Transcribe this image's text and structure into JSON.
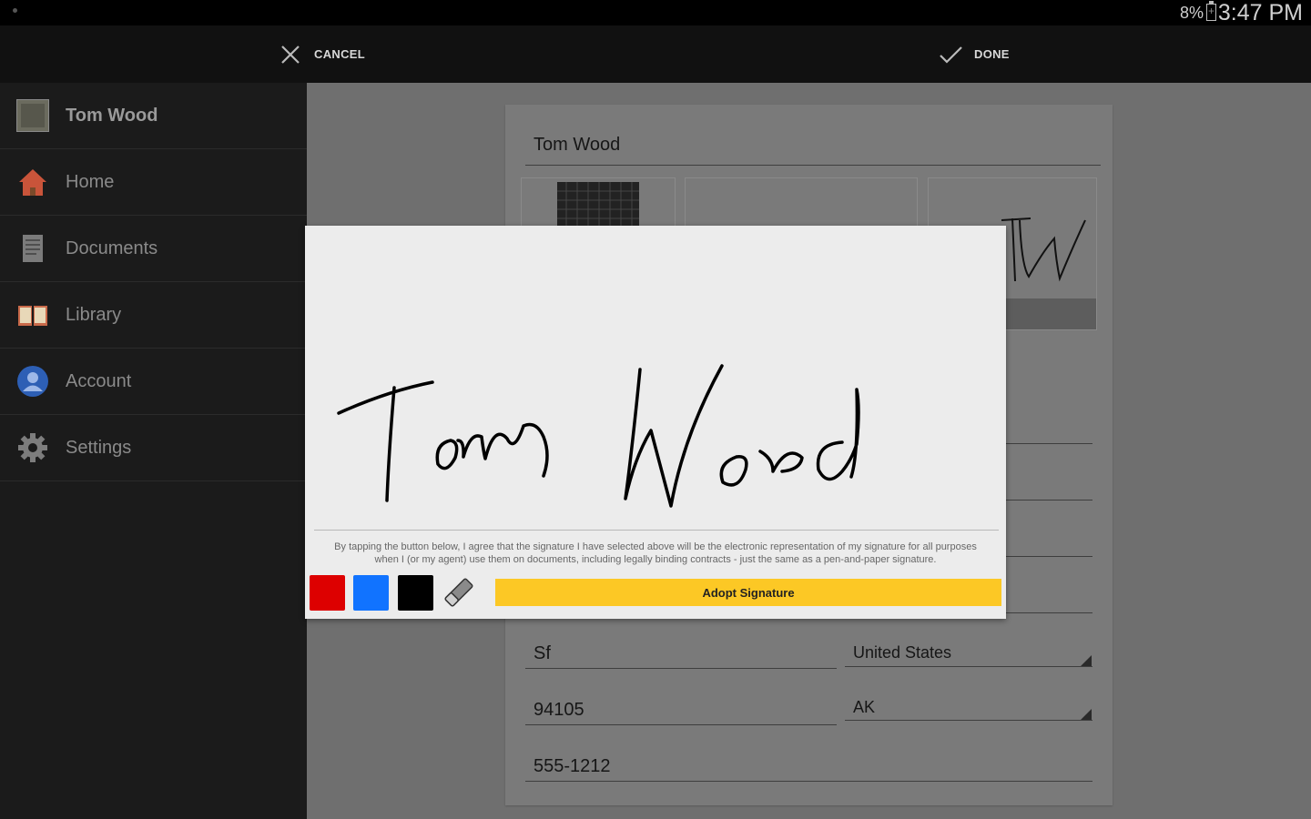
{
  "status_bar": {
    "battery": "8%",
    "time": "3:47 PM"
  },
  "action_bar": {
    "cancel_label": "CANCEL",
    "done_label": "DONE"
  },
  "sidebar": {
    "profile_name": "Tom Wood",
    "items": [
      {
        "label": "Home",
        "icon": "home-icon"
      },
      {
        "label": "Documents",
        "icon": "documents-icon"
      },
      {
        "label": "Library",
        "icon": "library-icon"
      },
      {
        "label": "Account",
        "icon": "account-icon"
      },
      {
        "label": "Settings",
        "icon": "settings-icon"
      }
    ]
  },
  "form": {
    "name": "Tom Wood",
    "city": "Sf",
    "country": "United States",
    "zip": "94105",
    "state": "AK",
    "phone": "555-1212"
  },
  "modal": {
    "signature_text": "Tom Wood",
    "legal_text_line1": "By tapping the button below, I agree that the signature I have selected above will be the electronic representation of my signature for all purposes",
    "legal_text_line2": "when I (or my agent) use them on documents, including legally binding contracts - just the same as a pen-and-paper signature.",
    "colors": {
      "red": "#dd0000",
      "blue": "#1173ff",
      "black": "#000000"
    },
    "adopt_label": "Adopt Signature",
    "accent": "#fcc825"
  }
}
